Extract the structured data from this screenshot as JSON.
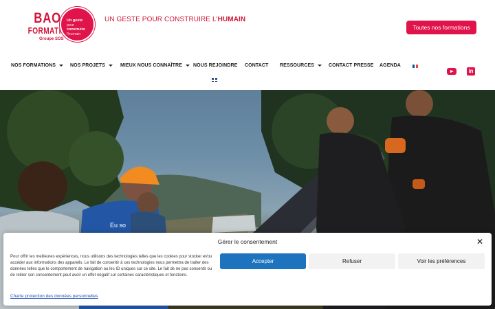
{
  "brand": {
    "logo_line1": "BAO",
    "logo_line2": "FORMATION",
    "logo_group": "Groupe SOS",
    "logo_circle": [
      "Un geste",
      "pour",
      "construire",
      "l'humain"
    ],
    "tagline_prefix": "UN GESTE POUR CONSTRUIRE L'",
    "tagline_emphasis": "HUMAIN",
    "accent_color": "#e0134a"
  },
  "header": {
    "cta_label": "Toutes nos formations"
  },
  "nav": {
    "items": [
      {
        "label": "NOS FORMATIONS",
        "dropdown": true
      },
      {
        "label": "NOS PROJETS",
        "dropdown": true
      },
      {
        "label": "MIEUX NOUS CONNAÎTRE",
        "dropdown": true
      },
      {
        "label": "NOUS REJOINDRE",
        "dropdown": false
      },
      {
        "label": "CONTACT",
        "dropdown": false
      },
      {
        "label": "RESSOURCES",
        "dropdown": true
      },
      {
        "label": "CONTACT PRESSE",
        "dropdown": false
      },
      {
        "label": "AGENDA",
        "dropdown": false
      }
    ],
    "languages": [
      "fr-flag-icon",
      "en-flag-icon"
    ],
    "social": [
      "youtube-icon",
      "linkedin-icon"
    ]
  },
  "hero": {
    "prev_label": "‹",
    "next_label": "›",
    "shirt_text": "Eu so"
  },
  "cookie": {
    "title": "Gérer le consentement",
    "close_label": "✕",
    "text": "Pour offrir les meilleures expériences, nous utilisons des technologies telles que les cookies pour stocker et/ou accéder aux informations des appareils. Le fait de consentir à ces technologies nous permettra de traiter des données telles que le comportement de navigation ou les ID uniques sur ce site. Le fait de ne pas consentir ou de retirer son consentement peut avoir un effet négatif sur certaines caractéristiques et fonctions.",
    "accept_label": "Accepter",
    "refuse_label": "Refuser",
    "prefs_label": "Voir les préférences",
    "policy_link": "Charte protection des données personnelles",
    "accept_color": "#1e73be"
  }
}
